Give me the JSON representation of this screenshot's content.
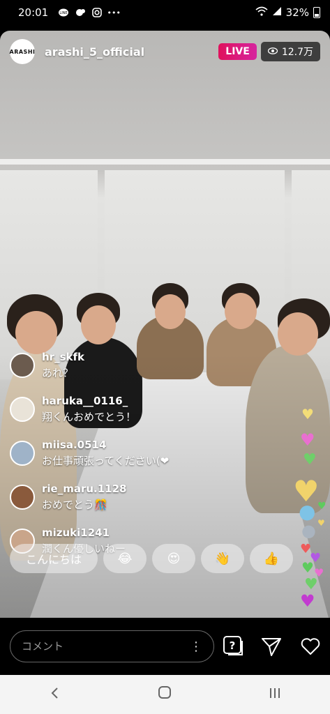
{
  "status_bar": {
    "time": "20:01",
    "battery": "32%"
  },
  "header": {
    "username": "arashi_5_official",
    "avatar_text": "ARASHI",
    "live_label": "LIVE",
    "viewers": "12.7万"
  },
  "comments": [
    {
      "user": "hr_skfk",
      "text": "あれ？",
      "avatar_color": "#6b5b4e"
    },
    {
      "user": "haruka__0116_",
      "text": "翔くんおめでとう！",
      "avatar_color": "#e9e3d8"
    },
    {
      "user": "miisa.0514",
      "text": "お仕事頑張ってください(❤",
      "avatar_color": "#9fb3c8"
    },
    {
      "user": "rie_maru.1128",
      "text": "おめでとう🎊",
      "avatar_color": "#8a5a3c"
    },
    {
      "user": "mizuki1241",
      "text": "潤くん優しいねー",
      "avatar_color": "#c9a58a"
    }
  ],
  "quick_replies": [
    "こんにちは",
    "😂",
    "😍",
    "👋",
    "👍"
  ],
  "bottom_bar": {
    "comment_placeholder": "コメント",
    "more_label": "⋮"
  },
  "colors": {
    "live": "#e1306c",
    "background": "#000000"
  }
}
